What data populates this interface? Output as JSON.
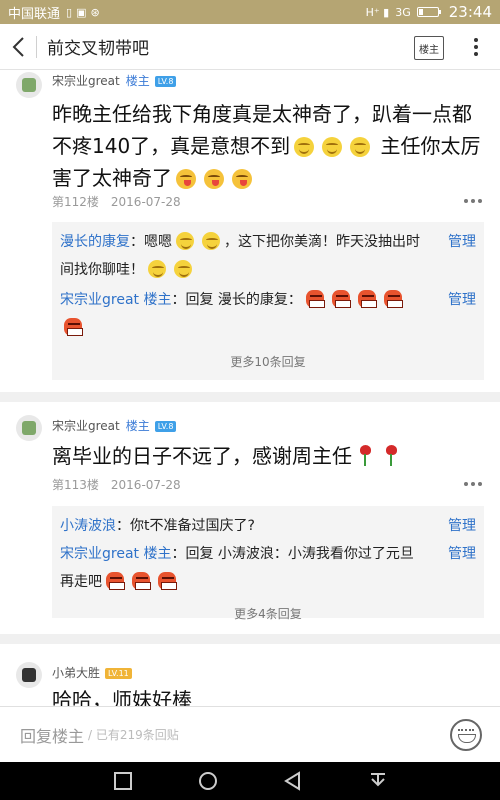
{
  "status_bar": {
    "carrier": "中国联通",
    "network": "3G",
    "time": "23:44"
  },
  "header": {
    "title": "前交叉韧带吧",
    "owner_button": "楼主"
  },
  "posts": [
    {
      "username": "宋宗业great",
      "owner_tag": "楼主",
      "level": "LV.8",
      "text_part1": "昨晚主任给我下角度真是太神奇了，趴着一点都不疼140了，真是意想不到",
      "text_part2": "主任你太厉害了太神奇了",
      "floor": "第112楼",
      "date": "2016-07-28",
      "replies": [
        {
          "who": "漫长的康复",
          "text_part1": "：嗯嗯",
          "text_part2": "，这下把你美滴！昨天没抽出时间找你聊哇！",
          "manage": "管理"
        },
        {
          "who": "宋宗业great 楼主",
          "text_part1": "：回复 漫长的康复：",
          "text_part2": "",
          "manage": "管理"
        }
      ],
      "more_replies": "更多10条回复"
    },
    {
      "username": "宋宗业great",
      "owner_tag": "楼主",
      "level": "LV.8",
      "text_part1": "离毕业的日子不远了，感谢周主任",
      "floor": "第113楼",
      "date": "2016-07-28",
      "replies": [
        {
          "who": "小涛波浪",
          "text_part1": "：你t不准备过国庆了?",
          "manage": "管理"
        },
        {
          "who": "宋宗业great 楼主",
          "text_part1": "：回复 小涛波浪：小涛我看你过了元旦再走吧",
          "manage": "管理"
        }
      ],
      "more_replies": "更多4条回复"
    },
    {
      "username": "小弟大胜",
      "level": "LV.11",
      "text_part1": "哈哈，师妹好棒"
    }
  ],
  "bottom_bar": {
    "reply_label": "回复楼主",
    "reply_count": "/ 已有219条回贴"
  },
  "icons": {
    "back": "chevron-left-icon",
    "more": "vertical-dots-icon",
    "emoji": "emoji-icon"
  }
}
